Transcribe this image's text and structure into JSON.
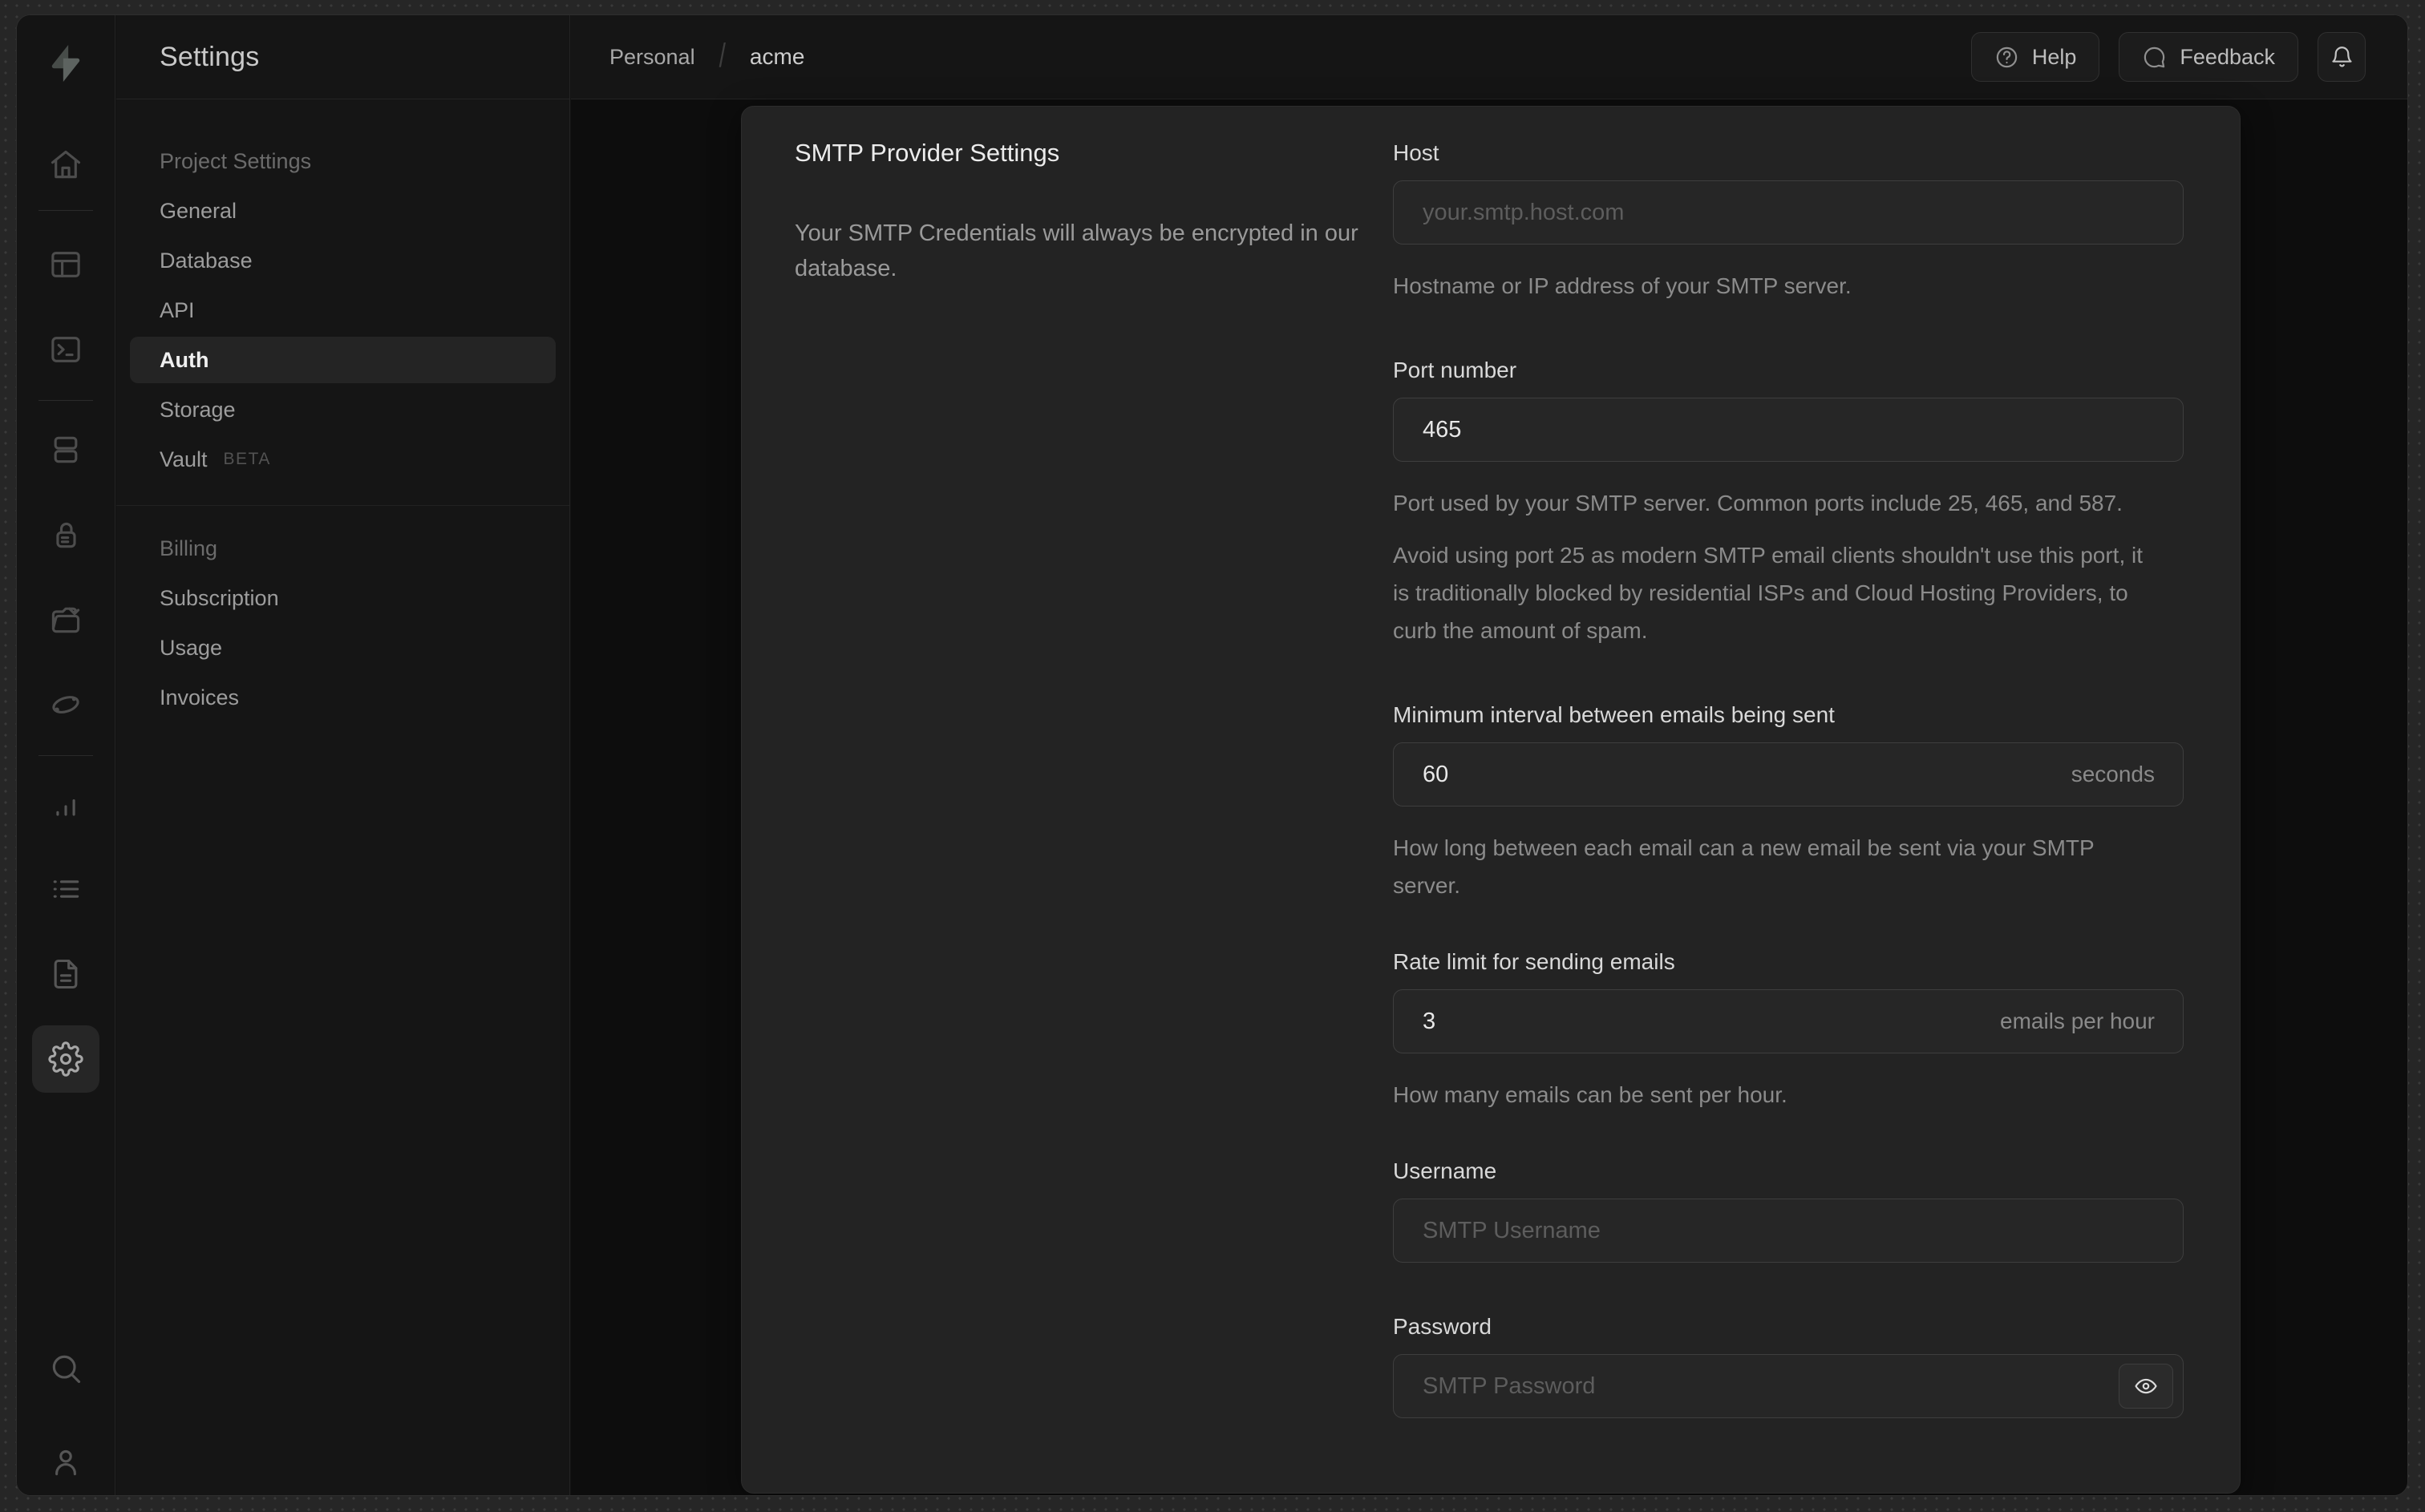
{
  "colors": {
    "brand_bolt_dark": "#474c49",
    "brand_bolt_light": "#5d6360",
    "card_bg": "#232323",
    "active_text": "#f0f0f0"
  },
  "sidebar": {
    "title": "Settings",
    "section1": {
      "heading": "Project Settings",
      "items": [
        "General",
        "Database",
        "API",
        "Auth",
        "Storage",
        "Vault"
      ]
    },
    "vault_badge": "BETA",
    "active_item": "Auth",
    "section2": {
      "heading": "Billing",
      "items": [
        "Subscription",
        "Usage",
        "Invoices"
      ]
    }
  },
  "header": {
    "breadcrumb_org": "Personal",
    "breadcrumb_separator": "/",
    "breadcrumb_project": "acme",
    "help_label": "Help",
    "feedback_label": "Feedback"
  },
  "content": {
    "section_title": "SMTP Provider Settings",
    "section_description": "Your SMTP Credentials will always be encrypted in our database.",
    "fields": [
      {
        "label": "Host",
        "placeholder": "your.smtp.host.com",
        "help": "Hostname or IP address of your SMTP server."
      },
      {
        "label": "Port number",
        "value": "465",
        "help": "Port used by your SMTP server. Common ports include 25, 465, and 587.",
        "help2": "Avoid using port 25 as modern SMTP email clients shouldn't use this port, it is traditionally blocked by residential ISPs and Cloud Hosting Providers, to curb the amount of spam."
      },
      {
        "label": "Minimum interval between emails being sent",
        "value": "60",
        "suffix": "seconds",
        "help": "How long between each email can a new email be sent via your SMTP server."
      },
      {
        "label": "Rate limit for sending emails",
        "value": "3",
        "suffix": "emails per hour",
        "help": "How many emails can be sent per hour."
      },
      {
        "label": "Username",
        "placeholder": "SMTP Username"
      },
      {
        "label": "Password",
        "placeholder": "SMTP Password"
      }
    ]
  }
}
